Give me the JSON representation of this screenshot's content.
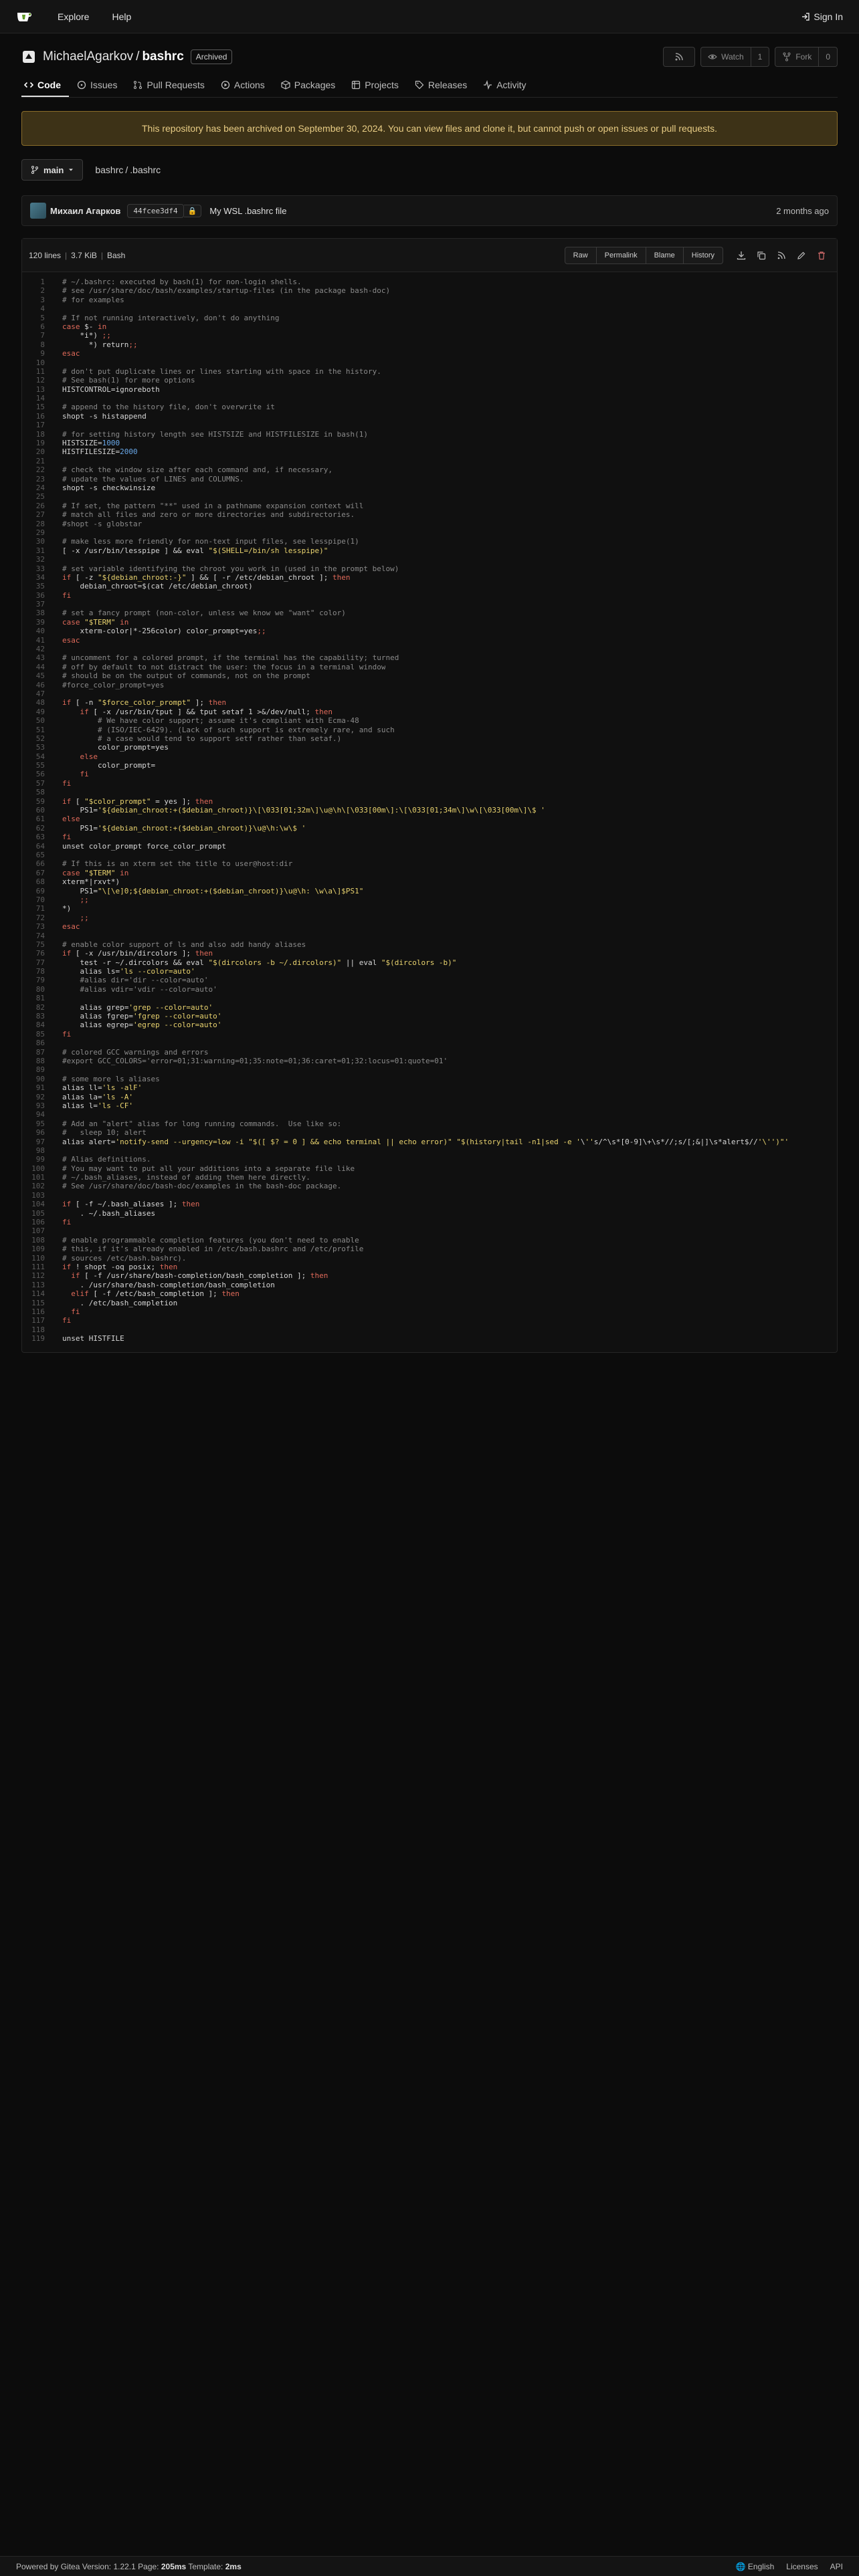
{
  "nav": {
    "explore": "Explore",
    "help": "Help",
    "signin": "Sign In"
  },
  "repo": {
    "owner": "MichaelAgarkov",
    "slash": "/",
    "name": "bashrc",
    "archived_badge": "Archived",
    "watch_label": "Watch",
    "watch_count": "1",
    "fork_label": "Fork",
    "fork_count": "0"
  },
  "tabs": [
    {
      "label": "Code",
      "icon": "code-icon"
    },
    {
      "label": "Issues",
      "icon": "issue-icon"
    },
    {
      "label": "Pull Requests",
      "icon": "pull-request-icon"
    },
    {
      "label": "Actions",
      "icon": "actions-icon"
    },
    {
      "label": "Packages",
      "icon": "package-icon"
    },
    {
      "label": "Projects",
      "icon": "project-icon"
    },
    {
      "label": "Releases",
      "icon": "tag-icon"
    },
    {
      "label": "Activity",
      "icon": "pulse-icon"
    }
  ],
  "archive_banner": "This repository has been archived on September 30, 2024. You can view files and clone it, but cannot push or open issues or pull requests.",
  "branch": {
    "name": "main"
  },
  "breadcrumb": {
    "repo": "bashrc",
    "sep": "/",
    "file": ".bashrc"
  },
  "commit": {
    "author": "Михаил Агарков",
    "sha": "44fcee3df4",
    "message": "My WSL .bashrc file",
    "time": "2 months ago"
  },
  "file": {
    "lines_info": "120 lines",
    "size": "3.7 KiB",
    "language": "Bash",
    "buttons": [
      "Raw",
      "Permalink",
      "Blame",
      "History"
    ]
  },
  "code_lines": [
    "# ~/.bashrc: executed by bash(1) for non-login shells.",
    "# see /usr/share/doc/bash/examples/startup-files (in the package bash-doc)",
    "# for examples",
    "",
    "# If not running interactively, don't do anything",
    "case $- in",
    "    *i*) ;;",
    "      *) return;;",
    "esac",
    "",
    "# don't put duplicate lines or lines starting with space in the history.",
    "# See bash(1) for more options",
    "HISTCONTROL=ignoreboth",
    "",
    "# append to the history file, don't overwrite it",
    "shopt -s histappend",
    "",
    "# for setting history length see HISTSIZE and HISTFILESIZE in bash(1)",
    "HISTSIZE=1000",
    "HISTFILESIZE=2000",
    "",
    "# check the window size after each command and, if necessary,",
    "# update the values of LINES and COLUMNS.",
    "shopt -s checkwinsize",
    "",
    "# If set, the pattern \"**\" used in a pathname expansion context will",
    "# match all files and zero or more directories and subdirectories.",
    "#shopt -s globstar",
    "",
    "# make less more friendly for non-text input files, see lesspipe(1)",
    "[ -x /usr/bin/lesspipe ] && eval \"$(SHELL=/bin/sh lesspipe)\"",
    "",
    "# set variable identifying the chroot you work in (used in the prompt below)",
    "if [ -z \"${debian_chroot:-}\" ] && [ -r /etc/debian_chroot ]; then",
    "    debian_chroot=$(cat /etc/debian_chroot)",
    "fi",
    "",
    "# set a fancy prompt (non-color, unless we know we \"want\" color)",
    "case \"$TERM\" in",
    "    xterm-color|*-256color) color_prompt=yes;;",
    "esac",
    "",
    "# uncomment for a colored prompt, if the terminal has the capability; turned",
    "# off by default to not distract the user: the focus in a terminal window",
    "# should be on the output of commands, not on the prompt",
    "#force_color_prompt=yes",
    "",
    "if [ -n \"$force_color_prompt\" ]; then",
    "    if [ -x /usr/bin/tput ] && tput setaf 1 >&/dev/null; then",
    "\t# We have color support; assume it's compliant with Ecma-48",
    "\t# (ISO/IEC-6429). (Lack of such support is extremely rare, and such",
    "\t# a case would tend to support setf rather than setaf.)",
    "\tcolor_prompt=yes",
    "    else",
    "\tcolor_prompt=",
    "    fi",
    "fi",
    "",
    "if [ \"$color_prompt\" = yes ]; then",
    "    PS1='${debian_chroot:+($debian_chroot)}\\[\\033[01;32m\\]\\u@\\h\\[\\033[00m\\]:\\[\\033[01;34m\\]\\w\\[\\033[00m\\]\\$ '",
    "else",
    "    PS1='${debian_chroot:+($debian_chroot)}\\u@\\h:\\w\\$ '",
    "fi",
    "unset color_prompt force_color_prompt",
    "",
    "# If this is an xterm set the title to user@host:dir",
    "case \"$TERM\" in",
    "xterm*|rxvt*)",
    "    PS1=\"\\[\\e]0;${debian_chroot:+($debian_chroot)}\\u@\\h: \\w\\a\\]$PS1\"",
    "    ;;",
    "*)",
    "    ;;",
    "esac",
    "",
    "# enable color support of ls and also add handy aliases",
    "if [ -x /usr/bin/dircolors ]; then",
    "    test -r ~/.dircolors && eval \"$(dircolors -b ~/.dircolors)\" || eval \"$(dircolors -b)\"",
    "    alias ls='ls --color=auto'",
    "    #alias dir='dir --color=auto'",
    "    #alias vdir='vdir --color=auto'",
    "",
    "    alias grep='grep --color=auto'",
    "    alias fgrep='fgrep --color=auto'",
    "    alias egrep='egrep --color=auto'",
    "fi",
    "",
    "# colored GCC warnings and errors",
    "#export GCC_COLORS='error=01;31:warning=01;35:note=01;36:caret=01;32:locus=01:quote=01'",
    "",
    "# some more ls aliases",
    "alias ll='ls -alF'",
    "alias la='ls -A'",
    "alias l='ls -CF'",
    "",
    "# Add an \"alert\" alias for long running commands.  Use like so:",
    "#   sleep 10; alert",
    "alias alert='notify-send --urgency=low -i \"$([ $? = 0 ] && echo terminal || echo error)\" \"$(history|tail -n1|sed -e '\\''s/^\\s*[0-9]\\+\\s*//;s/[;&|]\\s*alert$//'\\'')\"'",
    "",
    "# Alias definitions.",
    "# You may want to put all your additions into a separate file like",
    "# ~/.bash_aliases, instead of adding them here directly.",
    "# See /usr/share/doc/bash-doc/examples in the bash-doc package.",
    "",
    "if [ -f ~/.bash_aliases ]; then",
    "    . ~/.bash_aliases",
    "fi",
    "",
    "# enable programmable completion features (you don't need to enable",
    "# this, if it's already enabled in /etc/bash.bashrc and /etc/profile",
    "# sources /etc/bash.bashrc).",
    "if ! shopt -oq posix; then",
    "  if [ -f /usr/share/bash-completion/bash_completion ]; then",
    "    . /usr/share/bash-completion/bash_completion",
    "  elif [ -f /etc/bash_completion ]; then",
    "    . /etc/bash_completion",
    "  fi",
    "fi",
    "",
    "unset HISTFILE"
  ],
  "footer": {
    "powered": "Powered by Gitea",
    "version_label": "Version:",
    "version": "1.22.1",
    "page_label": "Page:",
    "page_time": "205ms",
    "template_label": "Template:",
    "template_time": "2ms",
    "language": "English",
    "licenses": "Licenses",
    "api": "API"
  },
  "colors": {
    "accent": "#609926",
    "banner_bg": "#3d3217",
    "banner_text": "#e8cc84",
    "keyword": "#e06a5a",
    "string": "#e8d26e",
    "number": "#69a8e8",
    "comment": "#8a8a8a"
  }
}
